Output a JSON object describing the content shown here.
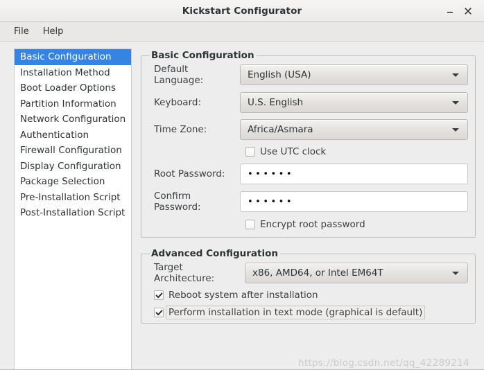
{
  "window": {
    "title": "Kickstart Configurator",
    "minimize_label": "minimize",
    "close_label": "close"
  },
  "menubar": {
    "items": [
      {
        "label": "File"
      },
      {
        "label": "Help"
      }
    ]
  },
  "sidebar": {
    "items": [
      {
        "label": "Basic Configuration",
        "selected": true
      },
      {
        "label": "Installation Method",
        "selected": false
      },
      {
        "label": "Boot Loader Options",
        "selected": false
      },
      {
        "label": "Partition Information",
        "selected": false
      },
      {
        "label": "Network Configuration",
        "selected": false
      },
      {
        "label": "Authentication",
        "selected": false
      },
      {
        "label": "Firewall Configuration",
        "selected": false
      },
      {
        "label": "Display Configuration",
        "selected": false
      },
      {
        "label": "Package Selection",
        "selected": false
      },
      {
        "label": "Pre-Installation Script",
        "selected": false
      },
      {
        "label": "Post-Installation Script",
        "selected": false
      }
    ]
  },
  "basic_group": {
    "title": "Basic Configuration",
    "language_label": "Default Language:",
    "language_value": "English (USA)",
    "keyboard_label": "Keyboard:",
    "keyboard_value": "U.S. English",
    "timezone_label": "Time Zone:",
    "timezone_value": "Africa/Asmara",
    "utc_label": "Use UTC clock",
    "utc_checked": false,
    "root_password_label": "Root Password:",
    "root_password_value": "••••••",
    "confirm_password_label": "Confirm Password:",
    "confirm_password_value": "••••••",
    "encrypt_label": "Encrypt root password",
    "encrypt_checked": false
  },
  "advanced_group": {
    "title": "Advanced Configuration",
    "arch_label": "Target Architecture:",
    "arch_value": "x86, AMD64, or Intel EM64T",
    "reboot_label": "Reboot system after installation",
    "reboot_checked": true,
    "textmode_label": "Perform installation in text mode (graphical is default)",
    "textmode_checked": true
  },
  "watermark": {
    "text": "https://blog.csdn.net/qq_42289214"
  },
  "colors": {
    "selection": "#3584e4",
    "window_bg": "#ededed",
    "list_bg": "#ffffff",
    "text": "#2e3436"
  }
}
